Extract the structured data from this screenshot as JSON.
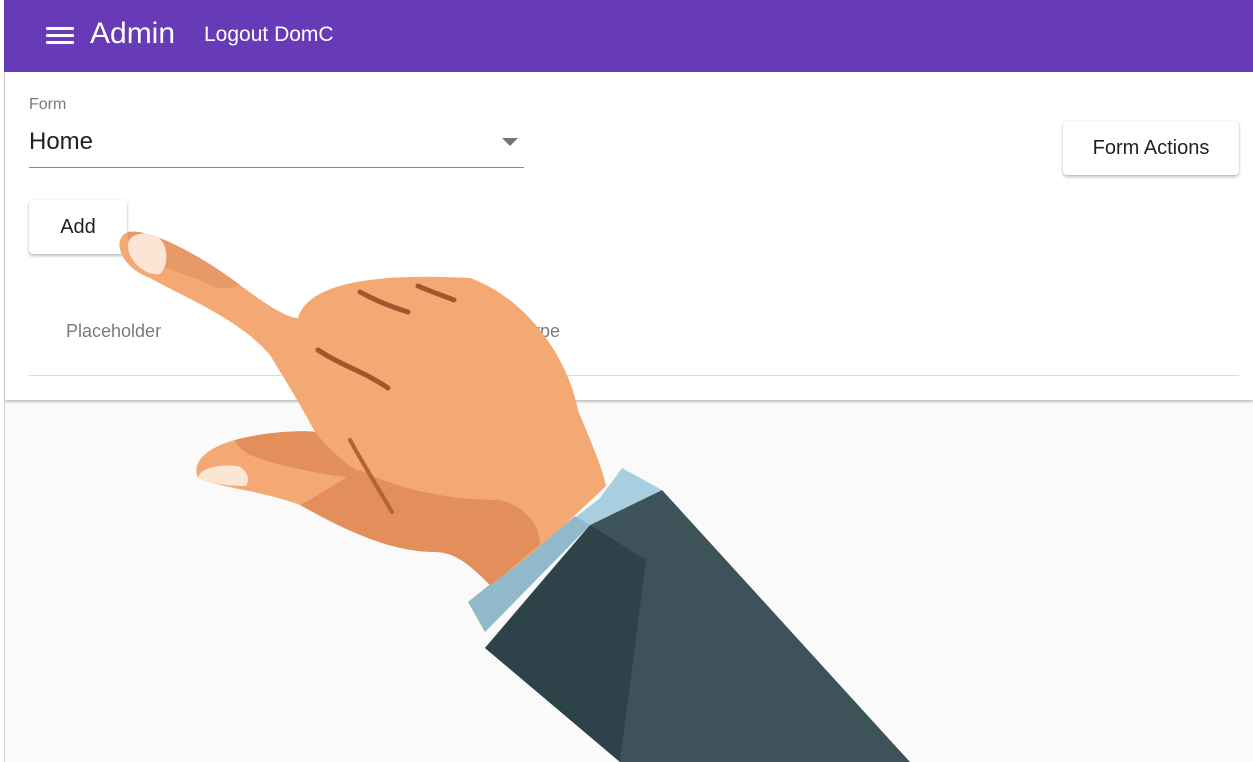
{
  "toolbar": {
    "title": "Admin",
    "logout_label": "Logout DomC",
    "menu_icon": "menu-icon",
    "color": "#673ab7"
  },
  "form": {
    "label": "Form",
    "value": "Home",
    "dropdown_icon": "arrow-drop-down-icon"
  },
  "buttons": {
    "add_label": "Add",
    "form_actions_label": "Form Actions"
  },
  "table": {
    "columns": [
      "Placeholder",
      "Type"
    ]
  },
  "overlay": {
    "icon": "pointing-hand-icon",
    "skin_color": "#f4a974",
    "sleeve_color": "#3d5259",
    "cuff_color": "#a8cfe0"
  }
}
